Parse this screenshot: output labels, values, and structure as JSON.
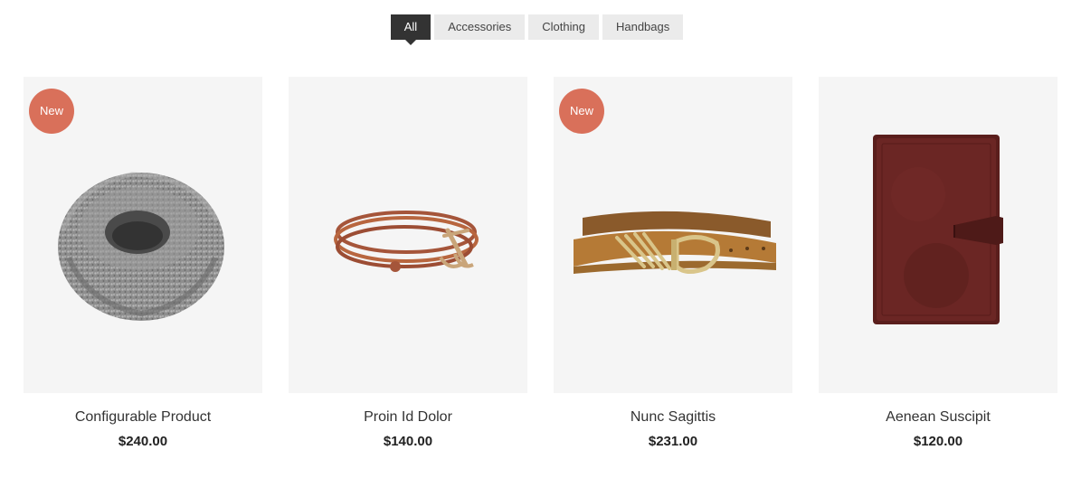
{
  "filter_tabs": [
    {
      "label": "All",
      "active": true
    },
    {
      "label": "Accessories",
      "active": false
    },
    {
      "label": "Clothing",
      "active": false
    },
    {
      "label": "Handbags",
      "active": false
    }
  ],
  "products": [
    {
      "name": "Configurable Product",
      "price": "$240.00",
      "badge": "New",
      "image_icon": "knit-scarf-image"
    },
    {
      "name": "Proin Id Dolor",
      "price": "$140.00",
      "badge": "",
      "image_icon": "leather-anchor-bracelet-image"
    },
    {
      "name": "Nunc Sagittis",
      "price": "$231.00",
      "badge": "New",
      "image_icon": "leather-belt-image"
    },
    {
      "name": "Aenean Suscipit",
      "price": "$120.00",
      "badge": "",
      "image_icon": "leather-wallet-image"
    }
  ],
  "colors": {
    "active_tab": "#333333",
    "inactive_tab": "#ebebeb",
    "badge": "#d9705a",
    "image_bg": "#f5f5f5"
  }
}
